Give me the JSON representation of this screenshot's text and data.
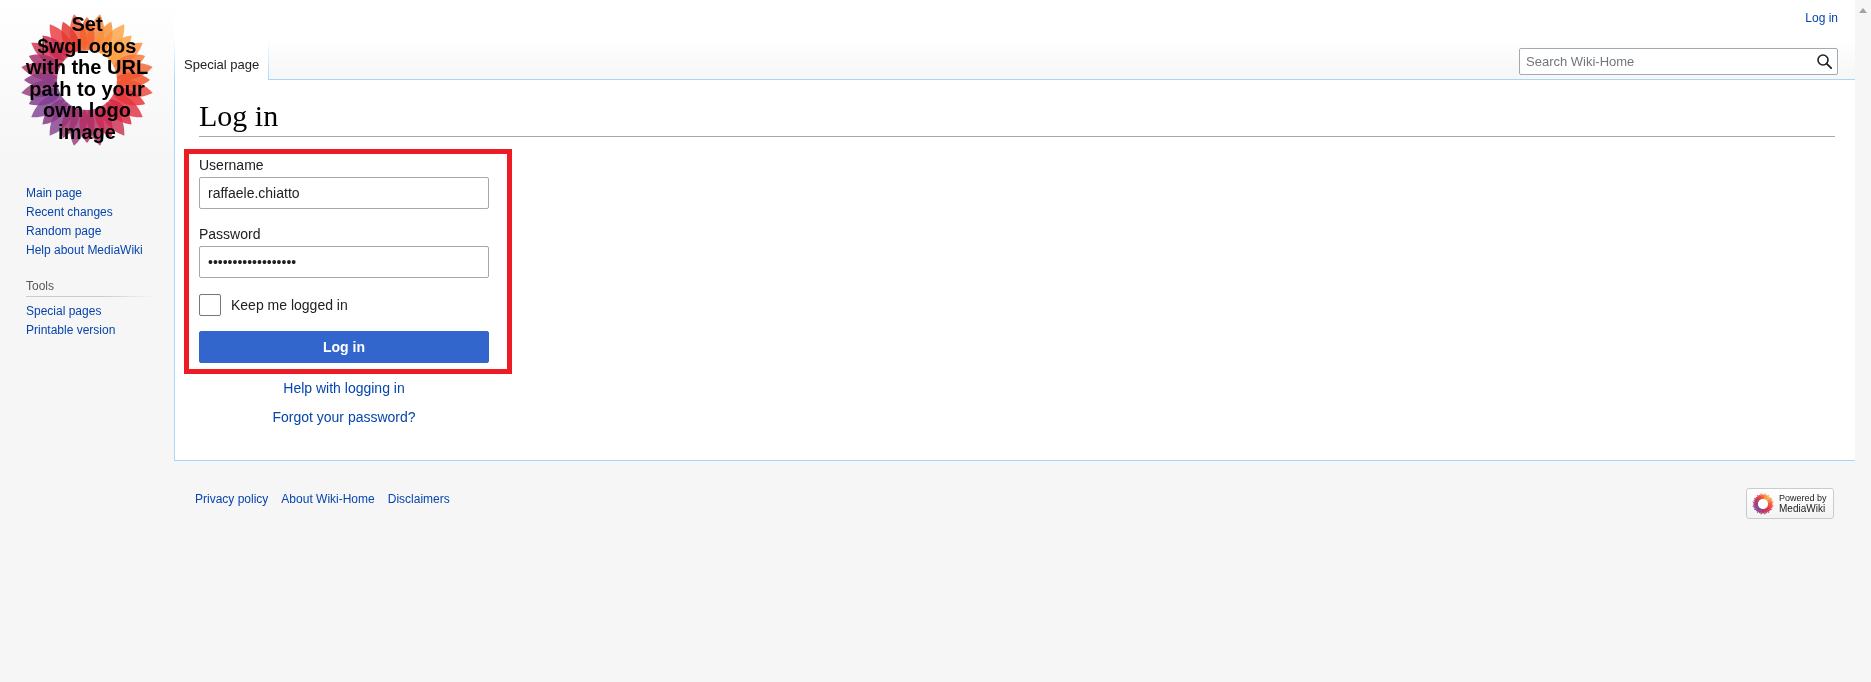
{
  "logo": {
    "text": "Set $wgLogos with the URL path to your own logo image"
  },
  "user_links": [
    {
      "label": "Log in"
    }
  ],
  "sidebar": {
    "navigation": [
      "Main page",
      "Recent changes",
      "Random page",
      "Help about MediaWiki"
    ],
    "sections": [
      {
        "heading": "Tools",
        "items": [
          "Special pages",
          "Printable version"
        ]
      }
    ]
  },
  "tabs": [
    {
      "label": "Special page",
      "selected": true
    }
  ],
  "search": {
    "placeholder": "Search Wiki-Home"
  },
  "page": {
    "title": "Log in",
    "form": {
      "username": {
        "label": "Username",
        "value": "raffaele.chiatto"
      },
      "password": {
        "label": "Password",
        "value": "••••••••••••••••••"
      },
      "remember": {
        "label": "Keep me logged in",
        "checked": false
      },
      "submit": "Log in"
    },
    "links": [
      "Help with logging in",
      "Forgot your password?"
    ]
  },
  "footer": {
    "links": [
      "Privacy policy",
      "About Wiki-Home",
      "Disclaimers"
    ],
    "badge": {
      "line_1": "Powered by",
      "line_2": "MediaWiki"
    }
  }
}
